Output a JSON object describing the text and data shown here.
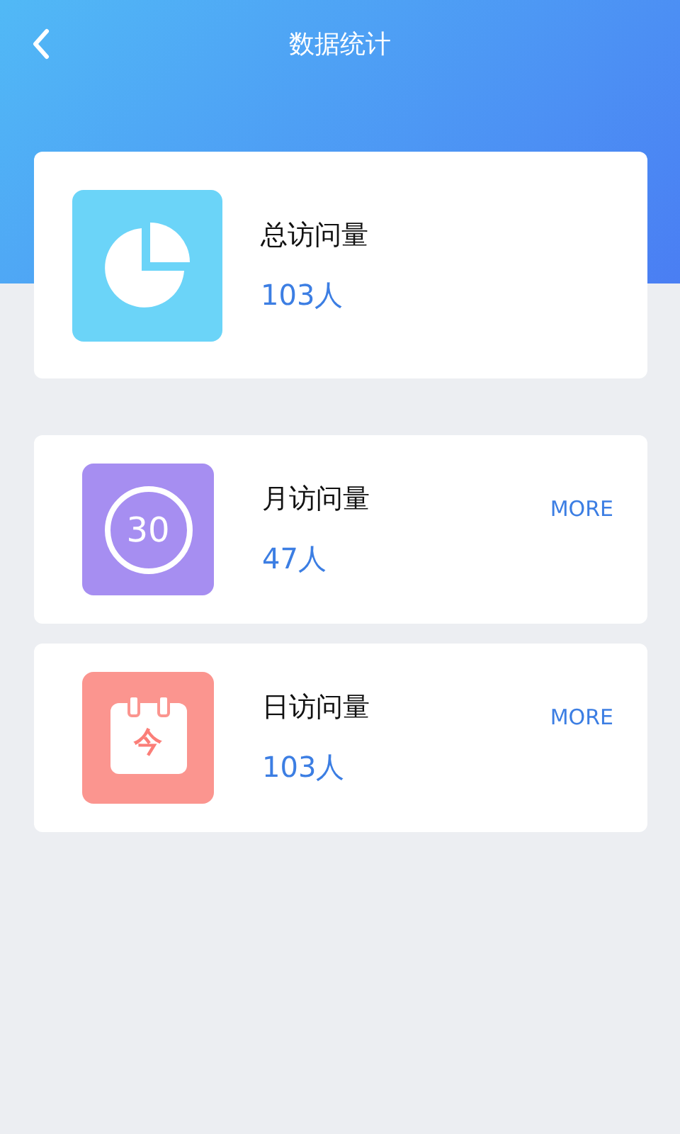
{
  "header": {
    "title": "数据统计"
  },
  "summary": {
    "label": "总访问量",
    "value": "103人"
  },
  "stats": [
    {
      "kind": "month",
      "badge": "30",
      "label": "月访问量",
      "value": "47人",
      "more": "MORE"
    },
    {
      "kind": "day",
      "badge": "今",
      "label": "日访问量",
      "value": "103人",
      "more": "MORE"
    }
  ]
}
